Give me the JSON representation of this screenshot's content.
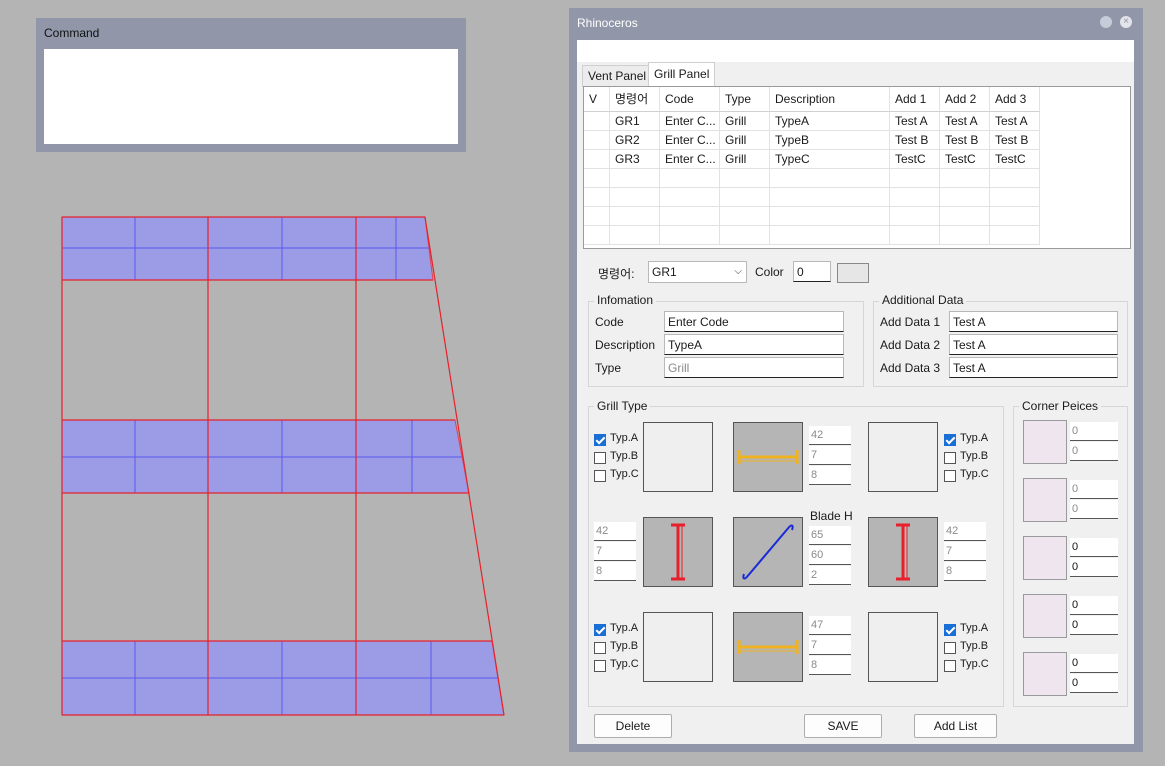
{
  "command": {
    "title": "Command"
  },
  "window": {
    "title": "Rhinoceros",
    "close": "×"
  },
  "tabs": [
    "Vent Panel",
    "Grill Panel"
  ],
  "grid": {
    "headers": [
      "V",
      "명령어",
      "Code",
      "Type",
      "Description",
      "Add 1",
      "Add 2",
      "Add 3"
    ],
    "rows": [
      [
        "",
        "GR1",
        "Enter C...",
        "Grill",
        "TypeA",
        "Test A",
        "Test A",
        "Test A"
      ],
      [
        "",
        "GR2",
        "Enter C...",
        "Grill",
        "TypeB",
        "Test B",
        "Test B",
        "Test B"
      ],
      [
        "",
        "GR3",
        "Enter C...",
        "Grill",
        "TypeC",
        "TestC",
        "TestC",
        "TestC"
      ]
    ]
  },
  "command_select": {
    "label": "명령어:",
    "value": "GR1"
  },
  "color": {
    "label": "Color",
    "value": "0"
  },
  "information": {
    "title": "Infomation",
    "code_label": "Code",
    "code_value": "Enter Code",
    "description_label": "Description",
    "description_value": "TypeA",
    "type_label": "Type",
    "type_value": "Grill"
  },
  "additional": {
    "title": "Additional Data",
    "items": [
      {
        "label": "Add Data 1",
        "value": "Test A"
      },
      {
        "label": "Add Data 2",
        "value": "Test A"
      },
      {
        "label": "Add Data 3",
        "value": "Test A"
      }
    ]
  },
  "grill_type": {
    "title": "Grill Type",
    "options": [
      "Typ.A",
      "Typ.B",
      "Typ.C"
    ],
    "top_values": [
      "42",
      "7",
      "8"
    ],
    "left_values": [
      "42",
      "7",
      "8"
    ],
    "right_values": [
      "42",
      "7",
      "8"
    ],
    "blade_label": "Blade H",
    "blade_values": [
      "65",
      "60",
      "2"
    ],
    "bottom_values": [
      "47",
      "7",
      "8"
    ]
  },
  "corners": {
    "title": "Corner Peices",
    "values": [
      [
        "0",
        "0"
      ],
      [
        "0",
        "0"
      ],
      [
        "0",
        "0"
      ],
      [
        "0",
        "0"
      ],
      [
        "0",
        "0"
      ]
    ]
  },
  "buttons": {
    "delete": "Delete",
    "save": "SAVE",
    "add_list": "Add List"
  },
  "colors": {
    "panel_fill": "#9b9be6",
    "panel_line": "#e0303a",
    "blade_yellow": "#f0b21e",
    "blade_red": "#e8202a",
    "blade_blue": "#1a2ad6"
  }
}
